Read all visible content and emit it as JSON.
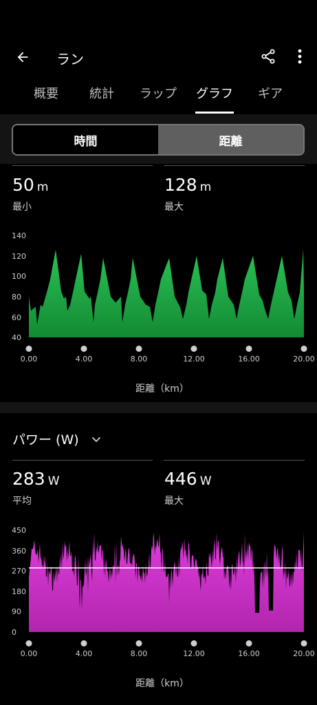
{
  "header": {
    "title": "ラン",
    "back_icon": "arrow-left-icon",
    "share_icon": "share-icon",
    "more_icon": "more-vert-icon"
  },
  "tabs": [
    {
      "label": "概要",
      "active": false
    },
    {
      "label": "統計",
      "active": false
    },
    {
      "label": "ラップ",
      "active": false
    },
    {
      "label": "グラフ",
      "active": true
    },
    {
      "label": "ギア",
      "active": false
    }
  ],
  "segment": {
    "left": "時間",
    "right": "距離",
    "selected": "距離"
  },
  "elevation": {
    "min": {
      "value": "50",
      "unit": "m",
      "label": "最小"
    },
    "max": {
      "value": "128",
      "unit": "m",
      "label": "最大"
    }
  },
  "power": {
    "metric_label": "パワー (W)",
    "avg": {
      "value": "283",
      "unit": "W",
      "label": "平均"
    },
    "max": {
      "value": "446",
      "unit": "W",
      "label": "最大"
    }
  },
  "colors": {
    "elevation_fill": "#1f9e3f",
    "power_fill": "#c72fc4",
    "avg_line": "#ffffff"
  },
  "chart_data": [
    {
      "type": "area",
      "xlabel": "距離（km）",
      "x_ticks": [
        "0.00",
        "4.00",
        "8.00",
        "12.00",
        "16.00",
        "20.00"
      ],
      "y_ticks": [
        "40",
        "60",
        "80",
        "100",
        "120",
        "140"
      ],
      "xlim": [
        0,
        20
      ],
      "ylim": [
        40,
        140
      ],
      "x": [
        0.0,
        0.15,
        0.3,
        0.5,
        0.6,
        0.7,
        0.85,
        1.0,
        1.3,
        1.55,
        1.95,
        2.35,
        2.55,
        2.7,
        2.8,
        3.0,
        3.2,
        3.4,
        3.8,
        4.05,
        4.4,
        4.5,
        4.7,
        4.8,
        5.0,
        5.2,
        5.4,
        5.95,
        6.3,
        6.7,
        6.8,
        7.0,
        7.2,
        7.4,
        7.55,
        8.1,
        8.5,
        8.8,
        9.0,
        9.2,
        9.4,
        9.6,
        10.2,
        10.6,
        10.9,
        11.0,
        11.2,
        11.45,
        11.6,
        12.2,
        12.6,
        12.9,
        13.1,
        13.3,
        13.55,
        13.7,
        14.1,
        14.5,
        14.8,
        14.9,
        15.1,
        15.3,
        15.5,
        15.7,
        16.3,
        16.75,
        17.0,
        17.15,
        17.4,
        17.6,
        17.8,
        18.4,
        18.85,
        19.1,
        19.3,
        19.5,
        19.7,
        19.95,
        20.0
      ],
      "elevation_values": [
        80,
        66,
        68,
        70,
        52,
        60,
        72,
        70,
        84,
        97,
        126,
        85,
        78,
        80,
        66,
        72,
        84,
        97,
        122,
        85,
        78,
        80,
        55,
        72,
        84,
        97,
        118,
        80,
        74,
        80,
        55,
        72,
        84,
        97,
        118,
        80,
        72,
        70,
        55,
        72,
        84,
        97,
        118,
        80,
        72,
        70,
        58,
        72,
        84,
        120,
        86,
        82,
        58,
        72,
        84,
        97,
        118,
        80,
        74,
        72,
        58,
        72,
        84,
        97,
        120,
        82,
        76,
        68,
        58,
        72,
        84,
        120,
        84,
        76,
        58,
        72,
        84,
        126,
        88
      ]
    },
    {
      "type": "area",
      "xlabel": "距離（km）",
      "x_ticks": [
        "0.00",
        "4.00",
        "8.00",
        "12.00",
        "16.00",
        "20.00"
      ],
      "y_ticks": [
        "0",
        "90",
        "180",
        "270",
        "360",
        "450"
      ],
      "xlim": [
        0,
        20
      ],
      "ylim": [
        0,
        450
      ],
      "average": 283,
      "series": [
        {
          "name": "パワー (W)"
        }
      ]
    }
  ]
}
